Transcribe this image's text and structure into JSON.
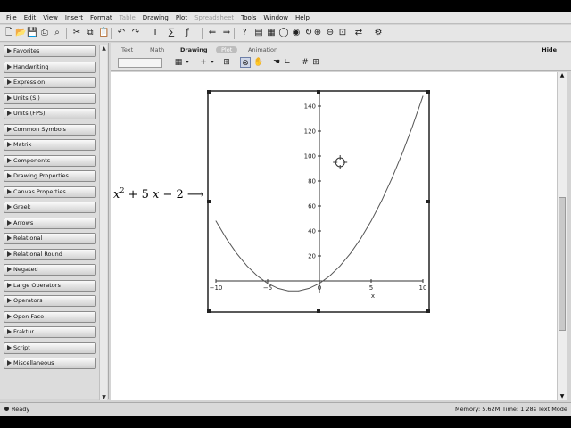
{
  "menu": [
    "File",
    "Edit",
    "View",
    "Insert",
    "Format",
    "Table",
    "Drawing",
    "Plot",
    "Spreadsheet",
    "Tools",
    "Window",
    "Help"
  ],
  "menu_disabled": [
    "Table",
    "Spreadsheet"
  ],
  "toolbar_icons": [
    "new-document-icon",
    "open-icon",
    "save-icon",
    "print-icon",
    "print-preview-icon",
    "cut-icon",
    "copy-icon",
    "paste-icon",
    "undo-icon",
    "redo-icon",
    "text-icon",
    "math-icon",
    "function-icon",
    "back-icon",
    "forward-icon",
    "help-icon",
    "image-icon",
    "grid-icon",
    "circle-icon",
    "stop-icon",
    "refresh-icon",
    "zoom-in-icon",
    "zoom-out-icon",
    "zoom-fit-icon",
    "swap-icon",
    "settings-icon"
  ],
  "palette": {
    "items": [
      "Favorites",
      "Handwriting",
      "Expression",
      "Units (SI)",
      "Units (FPS)",
      "Common Symbols",
      "Matrix",
      "Components",
      "Drawing Properties",
      "Canvas Properties",
      "Greek",
      "Arrows",
      "Relational",
      "Relational Round",
      "Negated",
      "Large Operators",
      "Operators",
      "Open Face",
      "Fraktur",
      "Script",
      "Miscellaneous"
    ]
  },
  "context_bar": {
    "tabs": [
      "Text",
      "Math",
      "Drawing",
      "Plot",
      "Animation"
    ],
    "active_tab": "Drawing",
    "hide_label": "Hide"
  },
  "document": {
    "expression": {
      "x": "x",
      "exp": "2",
      "rest": " + 5 ",
      "x2": "x",
      "tail": " − 2 ⟶"
    }
  },
  "chart_data": {
    "type": "line",
    "function": "x^2 + 5x - 2",
    "x": [
      -10,
      -9,
      -8,
      -7,
      -6,
      -5,
      -4,
      -3,
      -2,
      -1,
      0,
      1,
      2,
      3,
      4,
      5,
      6,
      7,
      8,
      9,
      10
    ],
    "y": [
      48,
      34,
      22,
      12,
      4,
      -2,
      -6,
      -8,
      -8,
      -6,
      -2,
      4,
      12,
      22,
      34,
      48,
      64,
      82,
      102,
      124,
      148
    ],
    "xlim": [
      -10,
      10
    ],
    "ylim": [
      -10,
      150
    ],
    "x_ticks": [
      "−10",
      "−5",
      "0",
      "5",
      "10"
    ],
    "y_ticks": [
      "20",
      "40",
      "60",
      "80",
      "100",
      "120",
      "140"
    ],
    "xlabel": "x",
    "ylabel": "",
    "grid": false,
    "line_color": "#555555"
  },
  "status": {
    "text": "Ready",
    "memory": "Memory: 5.62M",
    "time": "Time: 1.28s",
    "mode": "Text Mode"
  }
}
